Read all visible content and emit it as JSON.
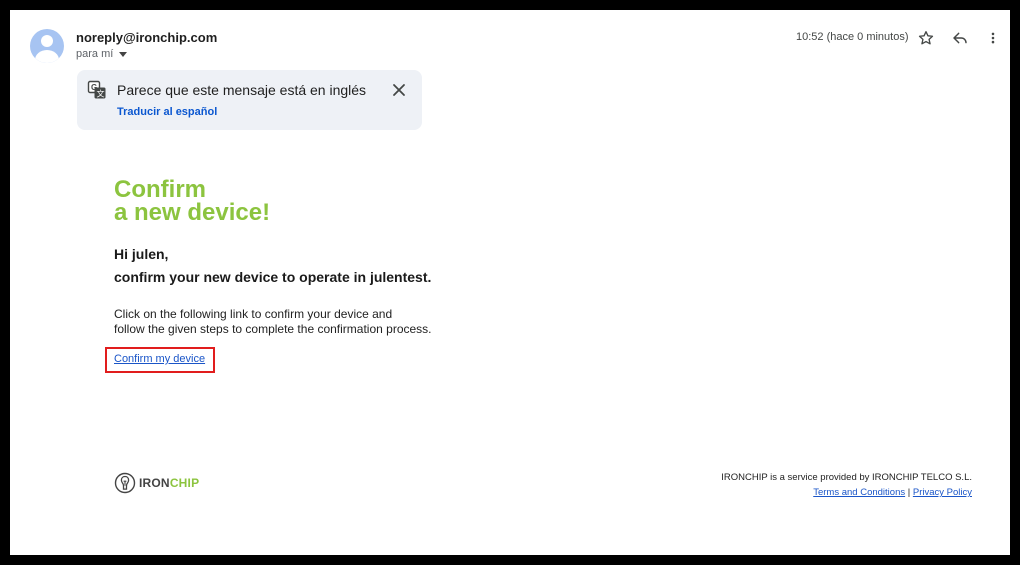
{
  "header": {
    "sender": "noreply@ironchip.com",
    "recipient": "para mí",
    "timestamp": "10:52 (hace 0 minutos)"
  },
  "translate_bar": {
    "message": "Parece que este mensaje está en inglés",
    "action": "Traducir al español"
  },
  "email": {
    "title_line1": "Confirm",
    "title_line2": "a new device!",
    "greeting": "Hi julen,",
    "subheading": "confirm your new device to operate in julentest.",
    "body_line1": "Click on the following link to confirm your device and",
    "body_line2": "follow the given steps to complete the confirmation process.",
    "confirm_link": "Confirm my device"
  },
  "footer": {
    "logo_iron": "IRON",
    "logo_chip": "CHIP",
    "service_text": "IRONCHIP is a service provided by IRONCHIP TELCO S.L.",
    "terms_link": "Terms and Conditions",
    "separator": "|",
    "privacy_link": "Privacy Policy"
  },
  "colors": {
    "accent_green": "#8cc43f",
    "link_blue": "#1a55c8",
    "highlight_red": "#e11d1d"
  }
}
